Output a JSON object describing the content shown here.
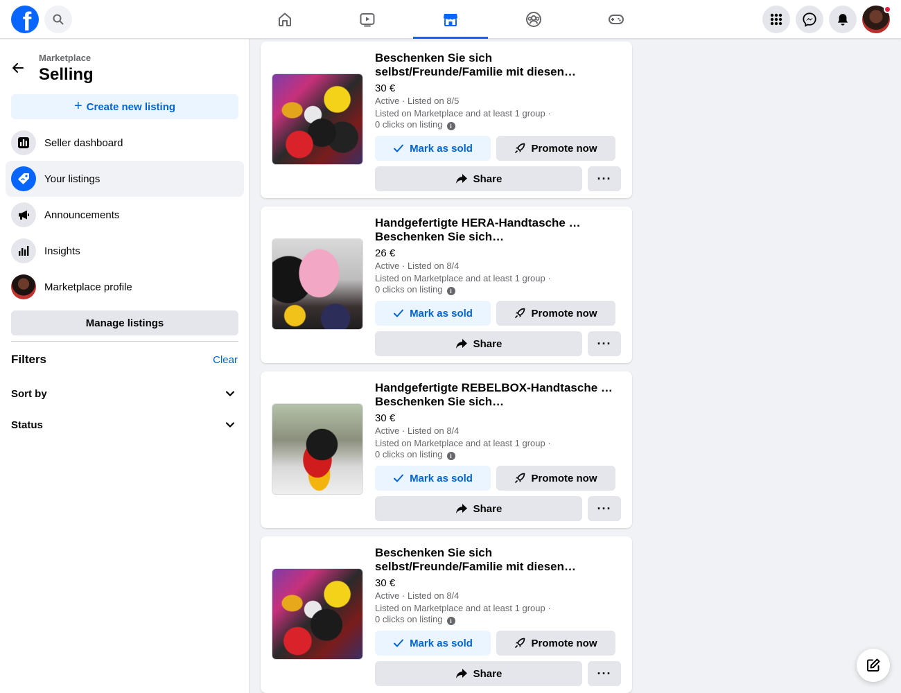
{
  "topbar": {
    "logo_letter": "f",
    "nav": [
      "home-icon",
      "watch-icon",
      "marketplace-icon",
      "groups-icon",
      "gaming-icon"
    ],
    "active_nav": "marketplace-icon",
    "brand_color": "#0866ff"
  },
  "sidebar": {
    "breadcrumb": "Marketplace",
    "title": "Selling",
    "create_label": "Create new listing",
    "items": [
      {
        "label": "Seller dashboard",
        "icon": "dashboard-icon"
      },
      {
        "label": "Your listings",
        "icon": "tag-icon",
        "active": true
      },
      {
        "label": "Announcements",
        "icon": "megaphone-icon"
      },
      {
        "label": "Insights",
        "icon": "bar-chart-icon"
      },
      {
        "label": "Marketplace profile",
        "icon": "avatar"
      }
    ],
    "manage_label": "Manage listings",
    "filters_title": "Filters",
    "clear_label": "Clear",
    "filters": [
      "Sort by",
      "Status"
    ]
  },
  "listings": [
    {
      "title_line1": "Beschenken Sie sich",
      "title_line2": "selbst/Freunde/Familie mit diesen…",
      "price": "30 €",
      "status": "Active · Listed on 8/5",
      "where": "Listed on Marketplace and at least 1 group ·",
      "clicks": "0 clicks on listing"
    },
    {
      "title_line1": "Handgefertigte HERA-Handtasche …",
      "title_line2": "Beschenken Sie sich…",
      "price": "26 €",
      "status": "Active · Listed on 8/4",
      "where": "Listed on Marketplace and at least 1 group ·",
      "clicks": "0 clicks on listing"
    },
    {
      "title_line1": "Handgefertigte REBELBOX-Handtasche …",
      "title_line2": "Beschenken Sie sich…",
      "price": "30 €",
      "status": "Active · Listed on 8/4",
      "where": "Listed on Marketplace and at least 1 group ·",
      "clicks": "0 clicks on listing"
    },
    {
      "title_line1": "Beschenken Sie sich",
      "title_line2": "selbst/Freunde/Familie mit diesen…",
      "price": "30 €",
      "status": "Active · Listed on 8/4",
      "where": "Listed on Marketplace and at least 1 group ·",
      "clicks": "0 clicks on listing"
    }
  ],
  "actions": {
    "mark_sold": "Mark as sold",
    "promote": "Promote now",
    "share": "Share",
    "more": "···"
  }
}
